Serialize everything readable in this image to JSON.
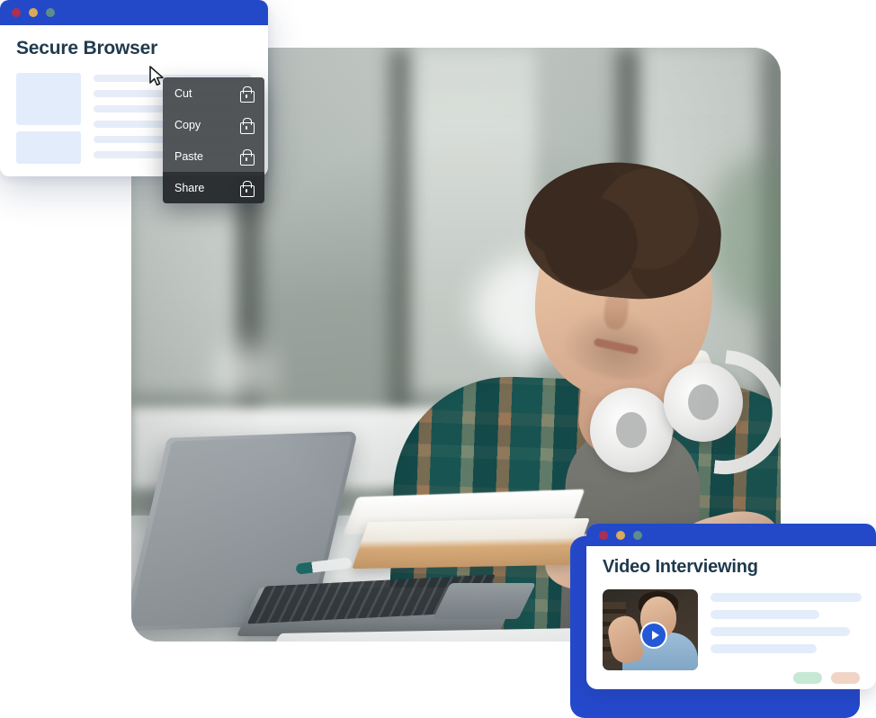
{
  "browser_window": {
    "title": "Secure Browser",
    "traffic_lights": [
      {
        "name": "close",
        "color": "#b02e4f"
      },
      {
        "name": "minimize",
        "color": "#d9a95c"
      },
      {
        "name": "maximize",
        "color": "#5f8d8b"
      }
    ],
    "titlebar_color": "#2349c9",
    "title_color": "#1f3a4d",
    "skeleton": {
      "blocks": [
        "block-large",
        "block-small"
      ],
      "line_widths": [
        "100%",
        "92%",
        "88%",
        "96%",
        "84%",
        "90%"
      ],
      "placeholder_color": "#e6edf8"
    }
  },
  "context_menu": {
    "items": [
      {
        "label": "Cut",
        "icon": "lock-icon",
        "locked": true
      },
      {
        "label": "Copy",
        "icon": "lock-icon",
        "locked": true
      },
      {
        "label": "Paste",
        "icon": "lock-icon",
        "locked": true
      },
      {
        "label": "Share",
        "icon": "lock-icon",
        "locked": true
      }
    ],
    "background": "rgba(68,72,74,0.93)",
    "highlight_background": "rgba(40,43,45,0.97)",
    "text_color": "#ffffff"
  },
  "cursor": {
    "icon": "arrow-pointer-icon"
  },
  "photo": {
    "alt": "Young man in teal and orange plaid flannel shirt with white over-ear headphones around his neck, working at a silver laptop with a notebook and pen on a desk in a blurred modern office",
    "corner_radius_px": 30
  },
  "video_card": {
    "title": "Video Interviewing",
    "titlebar_color": "#2349c9",
    "frame_color": "#2549cc",
    "traffic_lights": [
      {
        "name": "close",
        "color": "#b02e4f"
      },
      {
        "name": "minimize",
        "color": "#d9a95c"
      },
      {
        "name": "maximize",
        "color": "#5f8d8b"
      }
    ],
    "thumbnail": {
      "alt": "Smiling man in light blue shirt waving at the camera during a video call",
      "play_button": "play-icon",
      "play_button_color": "#2458d6"
    },
    "placeholder_lines": [
      "100%",
      "72%",
      "92%",
      "70%"
    ],
    "placeholder_color": "#e3ecfb",
    "pills": [
      {
        "name": "approve-pill",
        "color": "#c6e9d4"
      },
      {
        "name": "reject-pill",
        "color": "#f0d5c6"
      }
    ]
  }
}
